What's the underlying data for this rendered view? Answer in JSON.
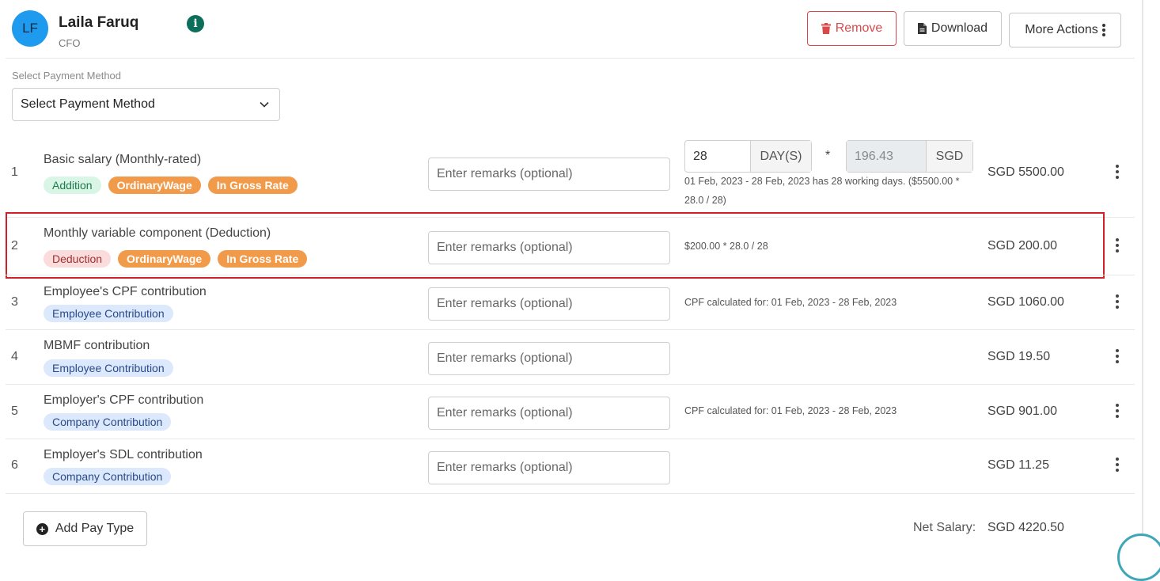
{
  "employee": {
    "initials": "LF",
    "name": "Laila Faruq",
    "role": "CFO"
  },
  "actions": {
    "remove": "Remove",
    "download": "Download",
    "more": "More Actions"
  },
  "payment_method": {
    "label": "Select Payment Method",
    "value": "Select Payment Method"
  },
  "remarks_placeholder": "Enter remarks (optional)",
  "rows": [
    {
      "num": "1",
      "name": "Basic salary (Monthly-rated)",
      "tags": [
        "Addition",
        "OrdinaryWage",
        "In Gross Rate"
      ],
      "days_value": "28",
      "days_unit": "DAY(S)",
      "operator": "*",
      "rate_value": "196.43",
      "rate_unit": "SGD",
      "note_line1": "01 Feb, 2023 - 28 Feb, 2023 has 28 working days. ($5500.00 *",
      "note_line2": "28.0 / 28)",
      "amount": "SGD 5500.00"
    },
    {
      "num": "2",
      "name": "Monthly variable component (Deduction)",
      "tags": [
        "Deduction",
        "OrdinaryWage",
        "In Gross Rate"
      ],
      "note": "$200.00 * 28.0 / 28",
      "amount": "SGD 200.00"
    },
    {
      "num": "3",
      "name": "Employee's CPF contribution",
      "tags": [
        "Employee Contribution"
      ],
      "note": "CPF calculated for: 01 Feb, 2023 - 28 Feb, 2023",
      "amount": "SGD 1060.00"
    },
    {
      "num": "4",
      "name": "MBMF contribution",
      "tags": [
        "Employee Contribution"
      ],
      "note": "",
      "amount": "SGD 19.50"
    },
    {
      "num": "5",
      "name": "Employer's CPF contribution",
      "tags": [
        "Company Contribution"
      ],
      "note": "CPF calculated for: 01 Feb, 2023 - 28 Feb, 2023",
      "amount": "SGD 901.00"
    },
    {
      "num": "6",
      "name": "Employer's SDL contribution",
      "tags": [
        "Company Contribution"
      ],
      "note": "",
      "amount": "SGD 11.25"
    }
  ],
  "footer": {
    "add_pay_type": "Add Pay Type",
    "net_salary_label": "Net Salary:",
    "net_salary_value": "SGD 4220.50"
  },
  "colors": {
    "avatar": "#1e9bef",
    "remove": "#d84a4a",
    "highlight": "#d0202a",
    "tag_orange": "#f19a4a",
    "tag_addition_bg": "#d9f5e6",
    "tag_deduction_bg": "#fadcdc",
    "tag_contribution_bg": "#dce8fb",
    "info_icon": "#0d6e5c"
  },
  "icons": {
    "info": "info-icon",
    "remove": "trash-icon",
    "download": "pdf-file-icon",
    "more": "kebab-vertical-icon",
    "select": "chevron-down-icon",
    "row_menu": "kebab-vertical-icon",
    "add": "plus-circle-icon"
  }
}
